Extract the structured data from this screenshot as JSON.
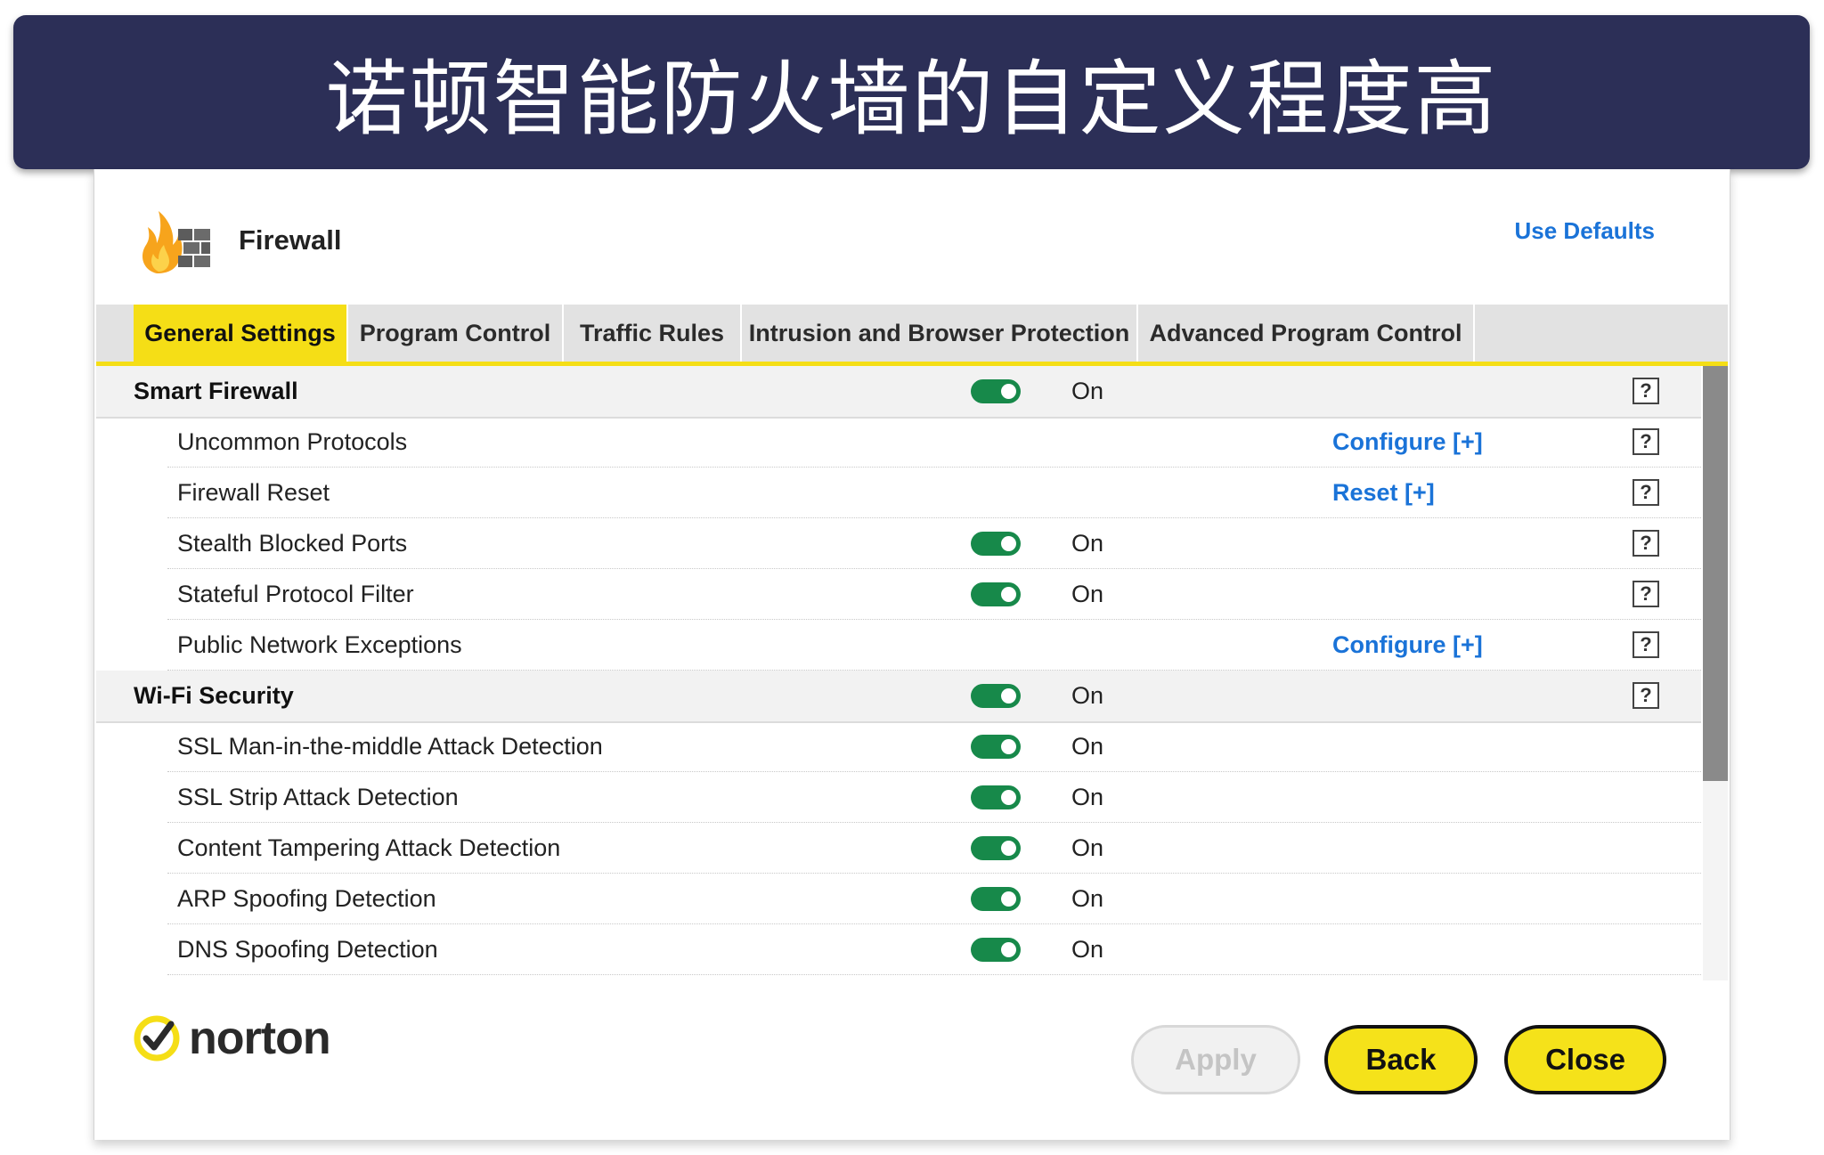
{
  "banner": {
    "title": "诺顿智能防火墙的自定义程度高"
  },
  "header": {
    "title": "Firewall",
    "use_defaults": "Use Defaults",
    "logo_icon": "firewall-flame-icon"
  },
  "tabs": [
    {
      "label": "General Settings",
      "active": true
    },
    {
      "label": "Program Control",
      "active": false
    },
    {
      "label": "Traffic Rules",
      "active": false
    },
    {
      "label": "Intrusion and Browser Protection",
      "active": false
    },
    {
      "label": "Advanced Program Control",
      "active": false
    }
  ],
  "rows": [
    {
      "type": "section",
      "label": "Smart Firewall",
      "toggle": true,
      "state": "On",
      "action": "",
      "help": "?"
    },
    {
      "type": "item",
      "label": "Uncommon Protocols",
      "toggle": false,
      "state": "",
      "action": "Configure [+]",
      "help": "?"
    },
    {
      "type": "item",
      "label": "Firewall Reset",
      "toggle": false,
      "state": "",
      "action": "Reset [+]",
      "help": "?"
    },
    {
      "type": "item",
      "label": "Stealth Blocked Ports",
      "toggle": true,
      "state": "On",
      "action": "",
      "help": "?"
    },
    {
      "type": "item",
      "label": "Stateful Protocol Filter",
      "toggle": true,
      "state": "On",
      "action": "",
      "help": "?"
    },
    {
      "type": "item",
      "label": "Public Network Exceptions",
      "toggle": false,
      "state": "",
      "action": "Configure [+]",
      "help": "?"
    },
    {
      "type": "section",
      "label": "Wi-Fi Security",
      "toggle": true,
      "state": "On",
      "action": "",
      "help": "?"
    },
    {
      "type": "item",
      "label": "SSL Man-in-the-middle Attack Detection",
      "toggle": true,
      "state": "On",
      "action": "",
      "help": ""
    },
    {
      "type": "item",
      "label": "SSL Strip Attack Detection",
      "toggle": true,
      "state": "On",
      "action": "",
      "help": ""
    },
    {
      "type": "item",
      "label": "Content Tampering Attack Detection",
      "toggle": true,
      "state": "On",
      "action": "",
      "help": ""
    },
    {
      "type": "item",
      "label": "ARP Spoofing Detection",
      "toggle": true,
      "state": "On",
      "action": "",
      "help": ""
    },
    {
      "type": "item",
      "label": "DNS Spoofing Detection",
      "toggle": true,
      "state": "On",
      "action": "",
      "help": ""
    }
  ],
  "footer": {
    "brand": "norton",
    "apply_label": "Apply",
    "back_label": "Back",
    "close_label": "Close"
  },
  "colors": {
    "banner_bg": "#2c2f57",
    "accent_yellow": "#f5de16",
    "toggle_on": "#17894a",
    "link_blue": "#1a73d8"
  }
}
